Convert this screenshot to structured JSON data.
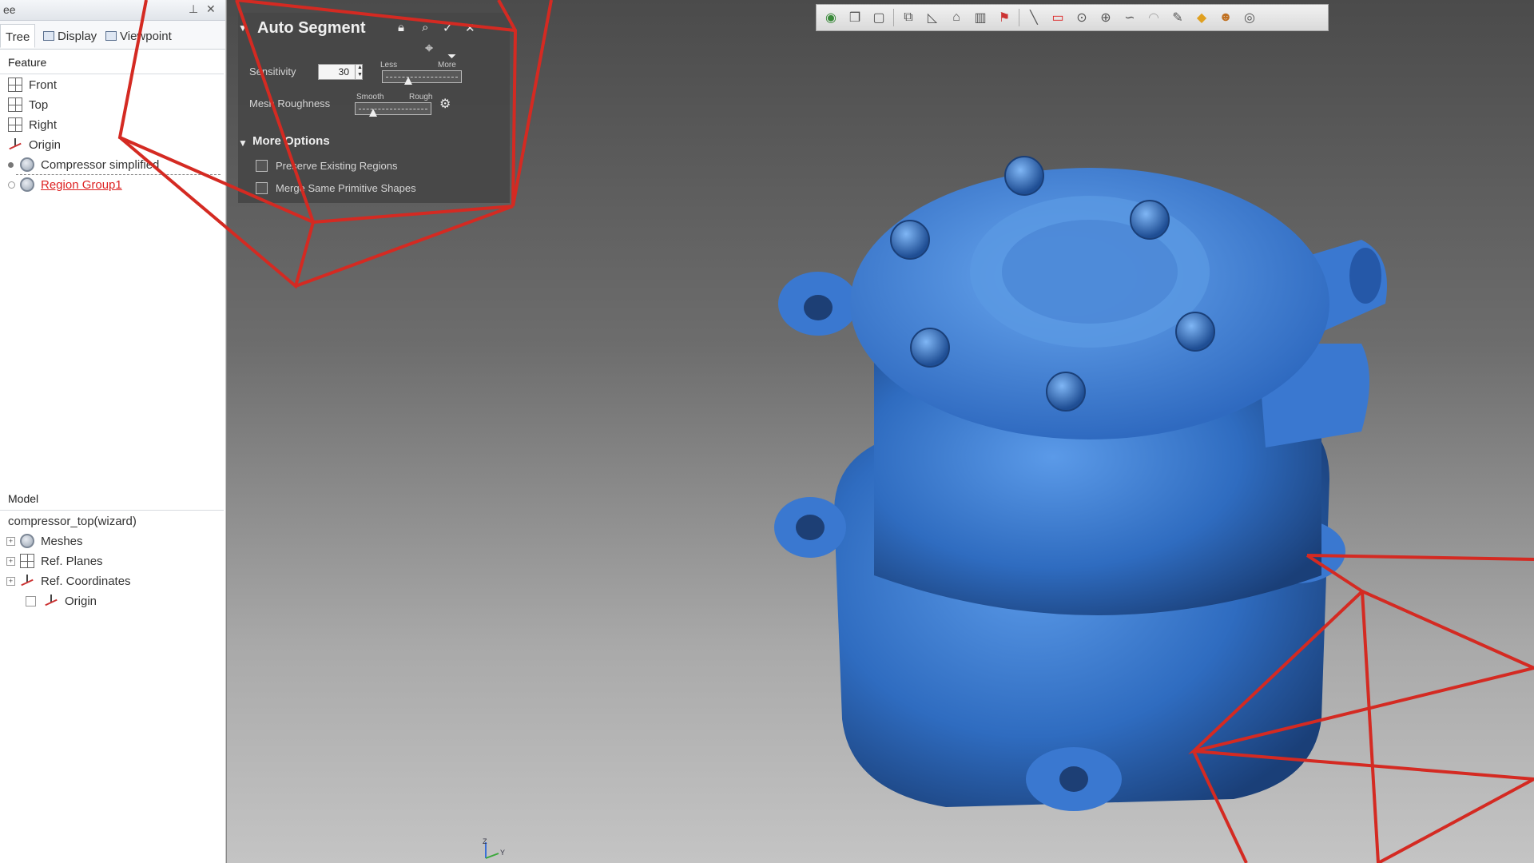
{
  "tree_panel": {
    "title": "ee",
    "tabs": [
      {
        "label": "Tree"
      },
      {
        "label": "Display"
      },
      {
        "label": "Viewpoint"
      }
    ],
    "feature_header": "Feature",
    "features": [
      {
        "label": "Front"
      },
      {
        "label": "Top"
      },
      {
        "label": "Right"
      },
      {
        "label": "Origin"
      },
      {
        "label": "Compressor simplified"
      },
      {
        "label": "Region Group1"
      }
    ],
    "model_header": "Model",
    "model_root": "compressor_top(wizard)",
    "model_items": [
      {
        "label": "Meshes"
      },
      {
        "label": "Ref. Planes"
      },
      {
        "label": "Ref. Coordinates"
      },
      {
        "label": "Origin"
      }
    ]
  },
  "dialog": {
    "title": "Auto Segment",
    "sensitivity_label": "Sensitivity",
    "sensitivity_value": "30",
    "sensitivity_min_label": "Less",
    "sensitivity_max_label": "More",
    "roughness_label": "Mesh Roughness",
    "roughness_min_label": "Smooth",
    "roughness_max_label": "Rough",
    "more_options_label": "More Options",
    "option_preserve": "Preserve Existing Regions",
    "option_merge": "Merge Same Primitive Shapes"
  },
  "colors": {
    "model_blue": "#3a7fd6",
    "overlay_red": "#d42a22",
    "link_red": "#dd2222"
  },
  "icons": {
    "toolbar": [
      "globe-icon",
      "cube-icon",
      "box-icon",
      "view-icon",
      "plane-icon",
      "sketch-icon",
      "section-icon",
      "measure-icon",
      "line-icon",
      "rectangle-icon",
      "circle-icon",
      "point-icon",
      "spline-icon",
      "arc-icon",
      "edit-icon",
      "fill-icon",
      "user-icon",
      "eye-icon"
    ]
  }
}
